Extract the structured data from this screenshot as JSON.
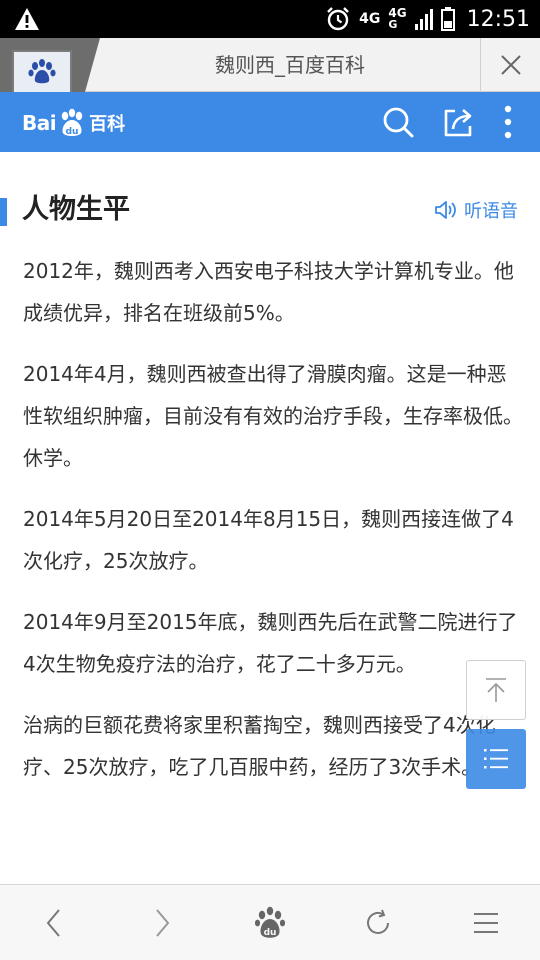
{
  "status_bar": {
    "time": "12:51",
    "network_primary": "4G",
    "network_secondary_top": "4G",
    "network_secondary_bottom": "G",
    "icons": [
      "warning-icon",
      "alarm-icon",
      "signal-icon",
      "battery-icon"
    ]
  },
  "tab": {
    "title": "魏则西_百度百科",
    "icons": [
      "baidu-paw-icon",
      "close-icon"
    ]
  },
  "header": {
    "logo_bai": "Bai",
    "logo_du": "du",
    "logo_baike": "百科",
    "accent_color": "#3c8ae6",
    "icons": [
      "search-icon",
      "share-icon",
      "more-vertical-icon"
    ]
  },
  "section": {
    "title": "人物生平",
    "listen_label": "听语音",
    "icons": [
      "speaker-icon"
    ]
  },
  "paragraphs": [
    "2012年，魏则西考入西安电子科技大学计算机专业。他成绩优异，排名在班级前5%。",
    "2014年4月，魏则西被查出得了滑膜肉瘤。这是一种恶性软组织肿瘤，目前没有有效的治疗手段，生存率极低。休学。",
    "2014年5月20日至2014年8月15日，魏则西接连做了4次化疗，25次放疗。",
    "2014年9月至2015年底，魏则西先后在武警二院进行了4次生物免疫疗法的治疗，花了二十多万元。",
    "治病的巨额花费将家里积蓄掏空，魏则西接受了4次化疗、25次放疗，吃了几百服中药，经历了3次手术。"
  ],
  "floating": {
    "icons": [
      "back-to-top-icon",
      "table-of-contents-icon"
    ]
  },
  "bottom_nav": {
    "icons": [
      "back-icon",
      "forward-icon",
      "home-paw-icon",
      "refresh-icon",
      "menu-icon"
    ],
    "home_label": "du"
  }
}
